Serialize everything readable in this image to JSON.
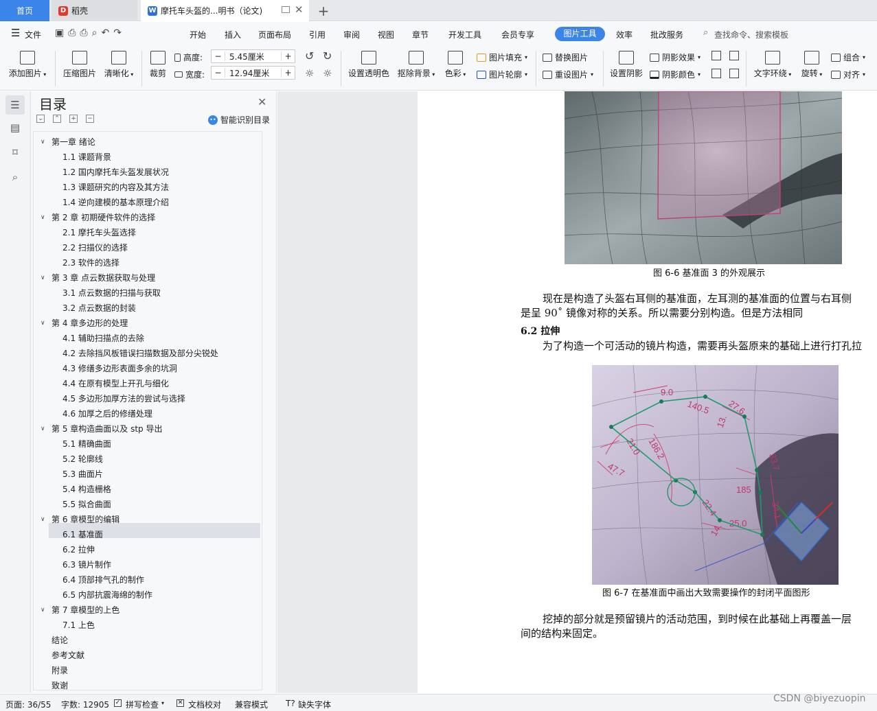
{
  "tabs": {
    "home": "首页",
    "daoke": "稻壳",
    "doc": "摩托车头盔的...明书（论文)"
  },
  "menu": {
    "file": "文件",
    "items": [
      "开始",
      "插入",
      "页面布局",
      "引用",
      "审阅",
      "视图",
      "章节",
      "开发工具",
      "会员专享",
      "图片工具",
      "效率",
      "批改服务"
    ],
    "active": "图片工具",
    "search_placeholder": "查找命令、搜索模板"
  },
  "ribbon": {
    "add_image": "添加图片",
    "compress": "压缩图片",
    "sharpen": "清晰化",
    "crop": "裁剪",
    "height_label": "高度:",
    "height_value": "5.45厘米",
    "width_label": "宽度:",
    "width_value": "12.94厘米",
    "transparent": "设置透明色",
    "remove_bg": "抠除背景",
    "color": "色彩",
    "fill": "图片填充",
    "outline": "图片轮廓",
    "replace": "替换图片",
    "reset": "重设图片",
    "shadow_set": "设置阴影",
    "shadow_effect": "阴影效果",
    "shadow_color": "阴影颜色",
    "wrap": "文字环绕",
    "rotate": "旋转",
    "group": "组合",
    "align": "对齐"
  },
  "toc": {
    "title": "目录",
    "smart": "智能识别目录",
    "items": [
      {
        "text": "第一章  绪论",
        "level": 1,
        "arrow": true
      },
      {
        "text": "1.1 课题背景",
        "level": 2
      },
      {
        "text": "1.2 国内摩托车头盔发展状况",
        "level": 2
      },
      {
        "text": "1.3 课题研究的内容及其方法",
        "level": 2
      },
      {
        "text": "1.4 逆向建模的基本原理介绍",
        "level": 2
      },
      {
        "text": "第 2 章  初期硬件软件的选择",
        "level": 1,
        "arrow": true
      },
      {
        "text": "2.1 摩托车头盔选择",
        "level": 2
      },
      {
        "text": "2.2 扫描仪的选择",
        "level": 2
      },
      {
        "text": "2.3  软件的选择",
        "level": 2
      },
      {
        "text": "第 3 章    点云数据获取与处理",
        "level": 1,
        "arrow": true
      },
      {
        "text": "3.1  点云数据的扫描与获取",
        "level": 2
      },
      {
        "text": "3.2  点云数据的封装",
        "level": 2
      },
      {
        "text": "第 4 章多边形的处理",
        "level": 1,
        "arrow": true
      },
      {
        "text": "4.1  辅助扫描点的去除",
        "level": 2
      },
      {
        "text": "4.2  去除挡风板错误扫描数据及部分尖锐处",
        "level": 2
      },
      {
        "text": "4.3  修缮多边形表面多余的坑洞",
        "level": 2
      },
      {
        "text": "4.4  在原有模型上开孔与细化",
        "level": 2
      },
      {
        "text": "4.5  多边形加厚方法的尝试与选择",
        "level": 2
      },
      {
        "text": "4.6  加厚之后的修缮处理",
        "level": 2
      },
      {
        "text": "第 5 章构造曲面以及 stp 导出",
        "level": 1,
        "arrow": true
      },
      {
        "text": "5.1  精确曲面",
        "level": 2
      },
      {
        "text": "5.2  轮廓线",
        "level": 2
      },
      {
        "text": "5.3  曲面片",
        "level": 2
      },
      {
        "text": "5.4  构造栅格",
        "level": 2
      },
      {
        "text": "5.5  拟合曲面",
        "level": 2
      },
      {
        "text": "第 6 章模型的编辑",
        "level": 1,
        "arrow": true
      },
      {
        "text": "6.1  基准面",
        "level": 2
      },
      {
        "text": "6.2  拉伸",
        "level": 2
      },
      {
        "text": "6.3  镜片制作",
        "level": 2
      },
      {
        "text": "6.4  顶部排气孔的制作",
        "level": 2
      },
      {
        "text": "6.5  内部抗震海绵的制作",
        "level": 2
      },
      {
        "text": "第 7 章模型的上色",
        "level": 1,
        "arrow": true
      },
      {
        "text": "7.1  上色",
        "level": 2
      },
      {
        "text": "结论",
        "level": 1
      },
      {
        "text": "参考文献",
        "level": 1
      },
      {
        "text": "附录",
        "level": 1
      },
      {
        "text": "致谢",
        "level": 1
      }
    ]
  },
  "document": {
    "fig6_6_caption": "图 6-6   基准面 3 的外观展示",
    "para1_line1": "现在是构造了头盔右耳侧的基准面，左耳测的基准面的位置与右耳侧",
    "para1_line2": "是呈 90˚ 镜像对称的关系。所以需要分别构造。但是方法相同",
    "section_heading": "6.2  拉伸",
    "para2_line1": "为了构造一个可活动的镜片构造，需要再头盔原来的基础上进行打孔拉",
    "fig6_7_caption": "图 6-7  在基准面中画出大致需要操作的封闭平面图形",
    "para3_line1": "挖掉的部分就是预留镜片的活动范围，到时候在此基础上再覆盖一层",
    "para3_line2": "间的结构来固定。",
    "dims": [
      "9.0",
      "27.6",
      "140.5",
      "13.",
      "33.7",
      "47.7",
      "21.0",
      "186.2",
      "22.4",
      "14.",
      "25.0",
      "185",
      "34.1"
    ]
  },
  "status": {
    "page": "页面: 36/55",
    "words": "字数: 12905",
    "spell": "拼写检查",
    "proof": "文档校对",
    "compat": "兼容模式",
    "missing_font": "缺失字体",
    "watermark": "CSDN @biyezuopin"
  }
}
